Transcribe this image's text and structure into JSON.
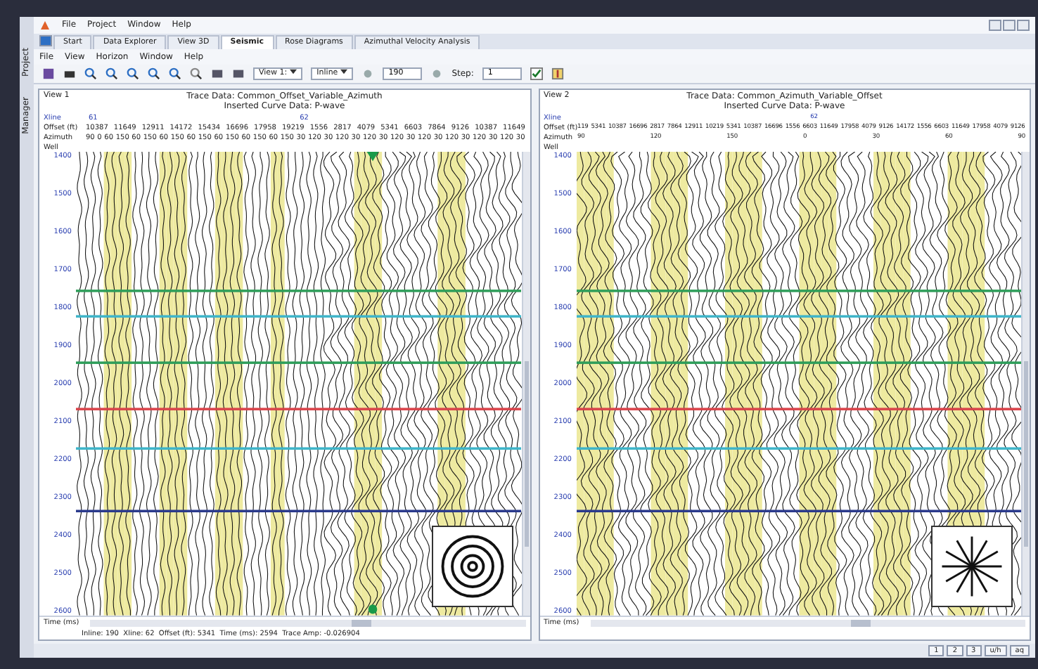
{
  "menu": [
    "File",
    "Project",
    "Window",
    "Help"
  ],
  "side_tabs": [
    "Project",
    "Manager"
  ],
  "tabs": [
    {
      "label": "Start",
      "selected": false
    },
    {
      "label": "Data Explorer",
      "selected": false
    },
    {
      "label": "View 3D",
      "selected": false
    },
    {
      "label": "Seismic",
      "selected": true
    },
    {
      "label": "Rose Diagrams",
      "selected": false
    },
    {
      "label": "Azimuthal Velocity Analysis",
      "selected": false
    }
  ],
  "submenu": [
    "File",
    "View",
    "Horizon",
    "Window",
    "Help"
  ],
  "toolbar": {
    "view_select": "View 1:",
    "direction_select": "Inline",
    "line_number": "190",
    "step_label": "Step:",
    "step": "1",
    "checkbox_checked": true
  },
  "views": [
    {
      "title": "View 1",
      "trace_data": "Trace Data: Common_Offset_Variable_Azimuth",
      "curve_data": "Inserted Curve Data: P-wave",
      "xline_label": "Xline",
      "xlines": [
        "61",
        "62"
      ],
      "offset_label": "Offset (ft)",
      "offsets": [
        "10387",
        "11649",
        "12911",
        "14172",
        "15434",
        "16696",
        "17958",
        "19219",
        "1556",
        "2817",
        "4079",
        "5341",
        "6603",
        "7864",
        "9126",
        "10387",
        "11649"
      ],
      "azimuth_label": "Azimuth",
      "azimuths": [
        "90",
        "0",
        "60",
        "150",
        "60",
        "150",
        "60",
        "150",
        "60",
        "150",
        "60",
        "150",
        "60",
        "150",
        "60",
        "150",
        "30",
        "120",
        "30",
        "120",
        "30",
        "120",
        "30",
        "120",
        "30",
        "120",
        "30",
        "120",
        "30",
        "120",
        "30",
        "120",
        "30"
      ],
      "well_label": "Well",
      "time_ticks": [
        "1400",
        "1500",
        "1600",
        "1700",
        "1800",
        "1900",
        "2000",
        "2100",
        "2200",
        "2300",
        "2400",
        "2500",
        "2600"
      ],
      "time_label": "Time (ms)",
      "kind": "rings",
      "cursor": true,
      "horizons": [
        {
          "color": "#2e9e5a"
        },
        {
          "color": "#3fb5c9"
        },
        {
          "color": "#2e9e5a"
        },
        {
          "color": "#d9434a"
        },
        {
          "color": "#3fb5c9"
        },
        {
          "color": "#2b3a8c"
        }
      ],
      "status": "Inline: 190  Xline: 62  Offset (ft): 5341  Time (ms): 2594  Trace Amp: -0.026904"
    },
    {
      "title": "View 2",
      "trace_data": "Trace Data: Common_Azimuth_Variable_Offset",
      "curve_data": "Inserted Curve Data: P-wave",
      "xline_label": "Xline",
      "xlines": [
        "62"
      ],
      "offset_label": "Offset (ft)",
      "offsets": [
        "119",
        "5341",
        "10387",
        "16696",
        "2817",
        "7864",
        "12911",
        "10219",
        "5341",
        "10387",
        "16696",
        "1556",
        "6603",
        "11649",
        "17958",
        "4079",
        "9126",
        "14172",
        "1556",
        "6603",
        "11649",
        "17958",
        "4079",
        "9126"
      ],
      "azimuth_label": "Azimuth",
      "azimuths": [
        "90",
        "120",
        "150",
        "0",
        "30",
        "60",
        "90"
      ],
      "well_label": "Well",
      "time_ticks": [
        "1400",
        "1500",
        "1600",
        "1700",
        "1800",
        "1900",
        "2000",
        "2100",
        "2200",
        "2300",
        "2400",
        "2500",
        "2600"
      ],
      "time_label": "Time (ms)",
      "kind": "star",
      "cursor": false,
      "horizons": [
        {
          "color": "#2e9e5a"
        },
        {
          "color": "#3fb5c9"
        },
        {
          "color": "#2e9e5a"
        },
        {
          "color": "#d9434a"
        },
        {
          "color": "#3fb5c9"
        },
        {
          "color": "#2b3a8c"
        }
      ]
    }
  ],
  "bottom_buttons": [
    "1",
    "2",
    "3",
    "u/h",
    "aq"
  ]
}
